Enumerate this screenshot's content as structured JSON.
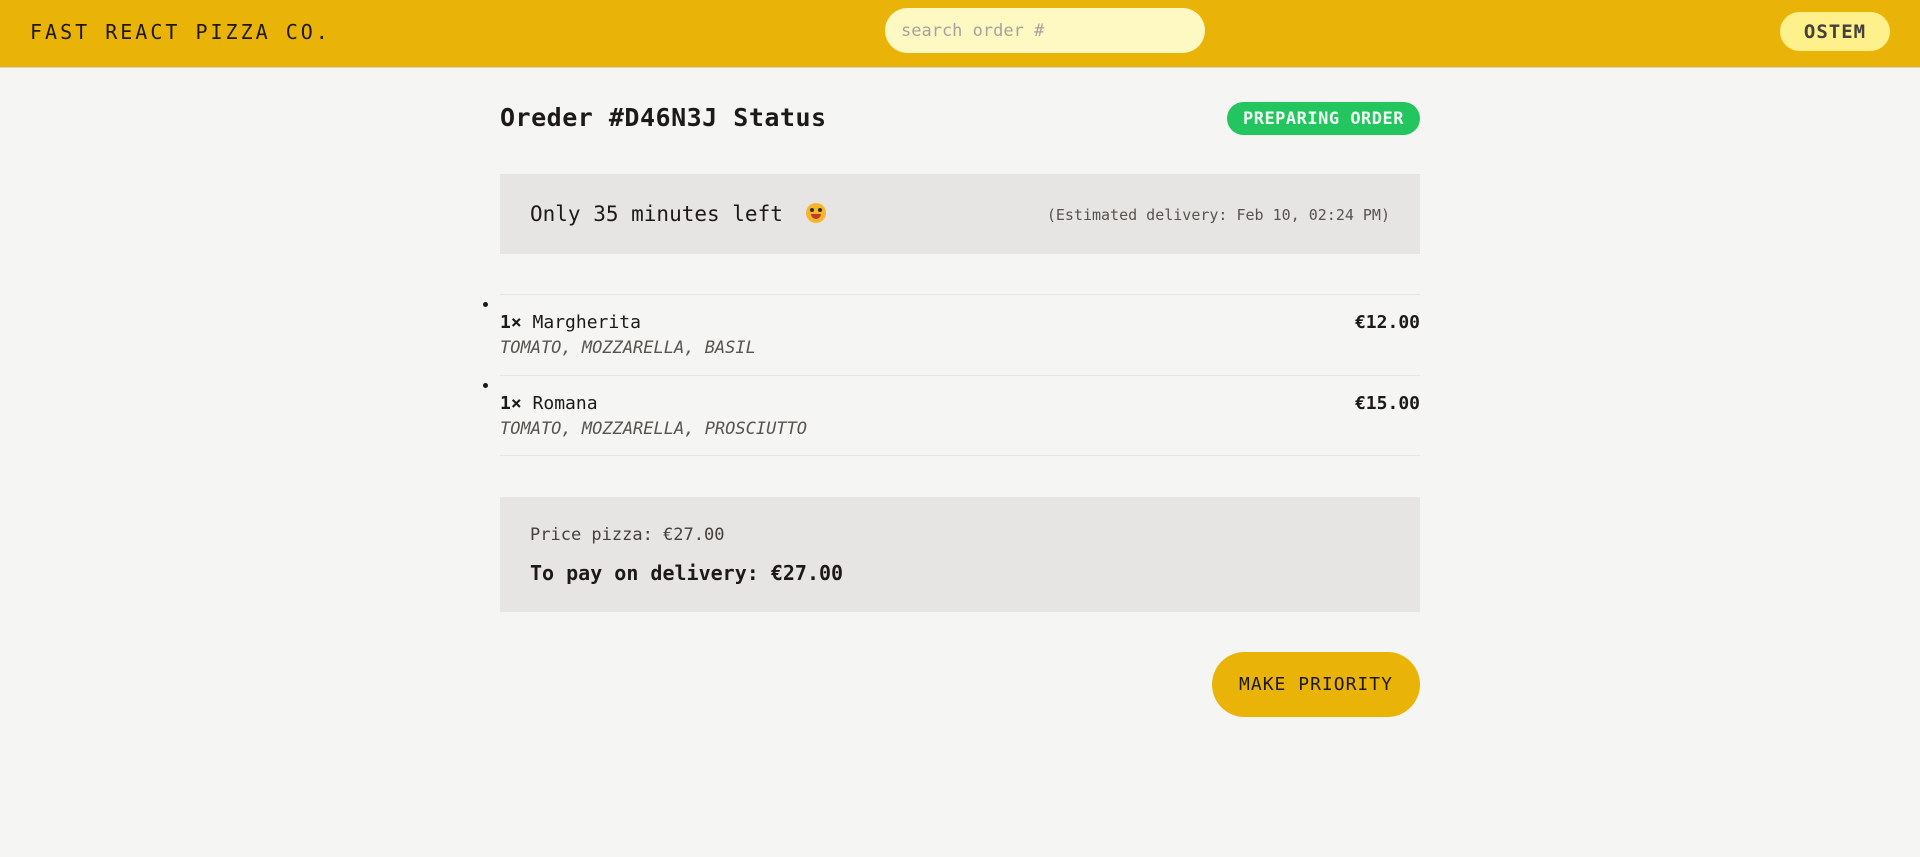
{
  "header": {
    "logo": "FAST REACT PIZZA CO.",
    "search_placeholder": "search order #",
    "search_value": "",
    "username": "OSTEM"
  },
  "order": {
    "title": "Oreder #D46N3J Status",
    "status": "PREPARING ORDER",
    "time_left": "Only 35 minutes left",
    "time_left_icon": "grinning-face-emoji",
    "estimated_delivery": "(Estimated delivery: Feb 10, 02:24 PM)",
    "items": [
      {
        "quantity": "1×",
        "name": "Margherita",
        "ingredients": "TOMATO, MOZZARELLA, BASIL",
        "price": "€12.00"
      },
      {
        "quantity": "1×",
        "name": "Romana",
        "ingredients": "TOMATO, MOZZARELLA, PROSCIUTTO",
        "price": "€15.00"
      }
    ],
    "price_pizza": "Price pizza: €27.00",
    "to_pay": "To pay on delivery: €27.00",
    "priority_button": "MAKE PRIORITY"
  },
  "colors": {
    "header_bg": "#eab308",
    "status_badge_bg": "#22c55e",
    "page_bg": "#f5f5f4",
    "panel_bg": "#e7e5e4"
  }
}
